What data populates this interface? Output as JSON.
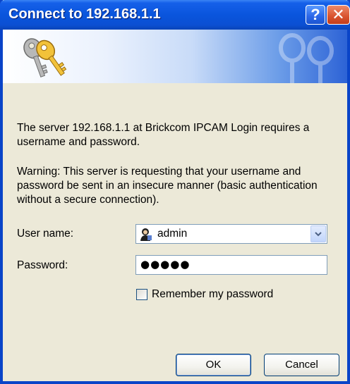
{
  "window": {
    "title": "Connect to 192.168.1.1"
  },
  "titlebar_buttons": {
    "help": "?",
    "close": "✕"
  },
  "banner": {
    "icon": "keys-icon"
  },
  "message": {
    "intro": "The server 192.168.1.1 at Brickcom IPCAM Login requires a username and password.",
    "warning": "Warning: This server is requesting that your username and password be sent in an insecure manner (basic authentication without a secure connection)."
  },
  "form": {
    "username_label": "User name:",
    "username_value": "admin",
    "password_label": "Password:",
    "password_value": "●●●●●",
    "remember_label": "Remember my password",
    "remember_checked": false
  },
  "buttons": {
    "ok": "OK",
    "cancel": "Cancel"
  },
  "colors": {
    "titlebar": "#0a55dd",
    "window_body": "#ece9d8",
    "close_button": "#d9532e"
  }
}
